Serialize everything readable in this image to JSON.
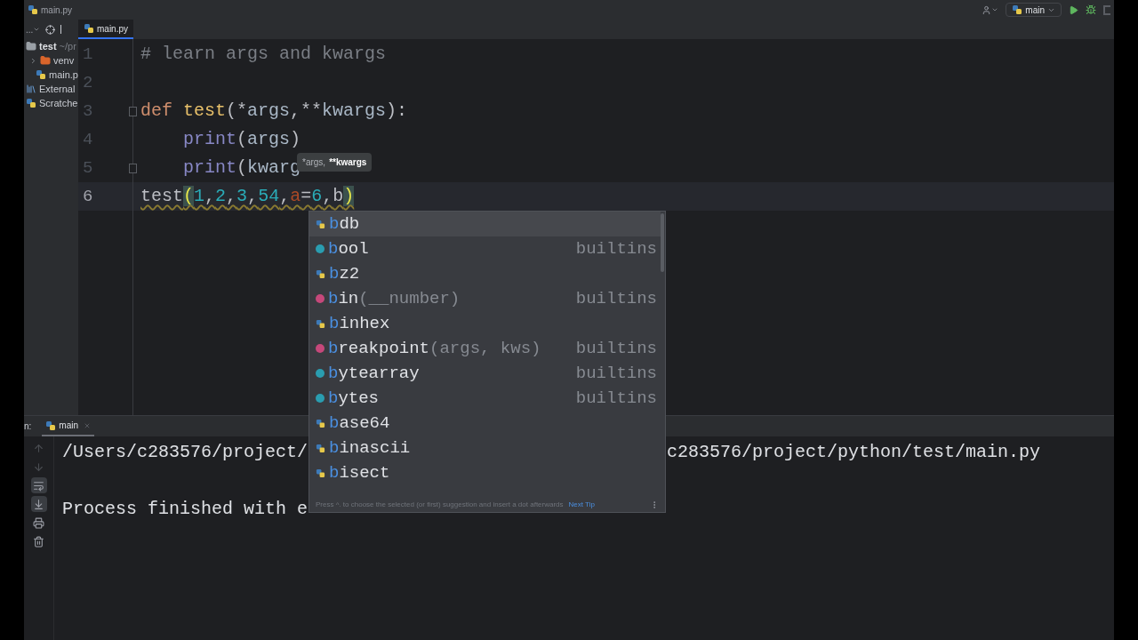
{
  "breadcrumb": "main.py",
  "run_config": {
    "label": "main"
  },
  "project_panel": {
    "toolbar_label": "...",
    "tree": [
      {
        "label": "test",
        "suffix": "~/pr",
        "kind": "folder",
        "children": [
          {
            "label": "venv",
            "kind": "venv",
            "expanded": false
          },
          {
            "label": "main.p",
            "kind": "python"
          }
        ]
      },
      {
        "label": "External",
        "kind": "libraries"
      },
      {
        "label": "Scratche",
        "kind": "scratches"
      }
    ]
  },
  "editor_tabs": [
    {
      "label": "main.py",
      "selected": true
    }
  ],
  "code_lines": [
    {
      "number": "1",
      "fold": false,
      "current": false,
      "tokens": [
        {
          "text": "# learn args and kwargs",
          "kind": "comment"
        }
      ]
    },
    {
      "number": "2",
      "fold": false,
      "current": false
    },
    {
      "number": "3",
      "fold": true,
      "current": false,
      "tokens": [
        {
          "text": "def ",
          "kind": "keyword"
        },
        {
          "text": "test",
          "kind": "function"
        },
        {
          "text": "(*",
          "kind": "plain"
        },
        {
          "text": "args",
          "kind": "param"
        },
        {
          "text": ",**",
          "kind": "plain"
        },
        {
          "text": "kwargs",
          "kind": "param"
        },
        {
          "text": "):",
          "kind": "plain"
        }
      ]
    },
    {
      "number": "4",
      "fold": false,
      "current": false,
      "indented": true,
      "tokens": [
        {
          "text": "print",
          "kind": "builtin"
        },
        {
          "text": "(",
          "kind": "plain"
        },
        {
          "text": "args",
          "kind": "param"
        },
        {
          "text": ")",
          "kind": "plain"
        }
      ]
    },
    {
      "number": "5",
      "fold": true,
      "current": false,
      "indented": true,
      "tokens": [
        {
          "text": "print",
          "kind": "builtin"
        },
        {
          "text": "(",
          "kind": "plain"
        },
        {
          "text": "kwarg",
          "kind": "param"
        }
      ]
    },
    {
      "number": "6",
      "fold": false,
      "current": true,
      "tokens": [
        {
          "text": "test",
          "kind": "plain"
        },
        {
          "text": "(",
          "kind": "brace"
        },
        {
          "text": "1",
          "kind": "number"
        },
        {
          "text": ",",
          "kind": "plain"
        },
        {
          "text": "2",
          "kind": "number"
        },
        {
          "text": ",",
          "kind": "plain"
        },
        {
          "text": "3",
          "kind": "number"
        },
        {
          "text": ",",
          "kind": "plain"
        },
        {
          "text": "54",
          "kind": "number"
        },
        {
          "text": ",",
          "kind": "plain"
        },
        {
          "text": "a",
          "kind": "keyarg"
        },
        {
          "text": "=",
          "kind": "plain"
        },
        {
          "text": "6",
          "kind": "number"
        },
        {
          "text": ",",
          "kind": "plain"
        },
        {
          "text": "b",
          "kind": "plain"
        },
        {
          "text": ")",
          "kind": "brace"
        }
      ]
    }
  ],
  "param_hint": [
    {
      "text": "*args,",
      "current": false
    },
    {
      "text": "**kwargs",
      "current": true
    }
  ],
  "completion": {
    "items": [
      {
        "prefix": "b",
        "name": "db",
        "kind": "module",
        "selected": true
      },
      {
        "prefix": "b",
        "name": "ool",
        "type": "builtins",
        "kind": "class",
        "selected": false
      },
      {
        "prefix": "b",
        "name": "z2",
        "kind": "module",
        "selected": false
      },
      {
        "prefix": "b",
        "name": "in",
        "tail": "(__number)",
        "type": "builtins",
        "kind": "function",
        "selected": false
      },
      {
        "prefix": "b",
        "name": "inhex",
        "kind": "module",
        "selected": false
      },
      {
        "prefix": "b",
        "name": "reakpoint",
        "tail": "(args, kws)",
        "type": "builtins",
        "kind": "function",
        "selected": false
      },
      {
        "prefix": "b",
        "name": "ytearray",
        "type": "builtins",
        "kind": "class",
        "selected": false
      },
      {
        "prefix": "b",
        "name": "ytes",
        "type": "builtins",
        "kind": "class",
        "selected": false
      },
      {
        "prefix": "b",
        "name": "ase64",
        "kind": "module",
        "selected": false
      },
      {
        "prefix": "b",
        "name": "inascii",
        "kind": "module",
        "selected": false
      },
      {
        "prefix": "b",
        "name": "isect",
        "kind": "module",
        "selected": false
      }
    ],
    "footer": "Press ^. to choose the selected (or first) suggestion and insert a dot afterwards",
    "footer_link": "Next Tip"
  },
  "run_panel": {
    "label": "n:",
    "tab": "main",
    "tools": [
      {
        "kind": "up",
        "disabled": true
      },
      {
        "kind": "down",
        "disabled": true
      },
      {
        "kind": "wrap",
        "disabled": false
      },
      {
        "kind": "scroll",
        "disabled": false
      },
      {
        "kind": "print",
        "disabled": false
      },
      {
        "kind": "trash",
        "disabled": false
      }
    ]
  },
  "console": [
    {
      "left": "/Users/c283576/project/",
      "right": "c283576/project/python/test/main.py"
    },
    {
      "left": "Process finished with e",
      "gap_before": true
    }
  ]
}
